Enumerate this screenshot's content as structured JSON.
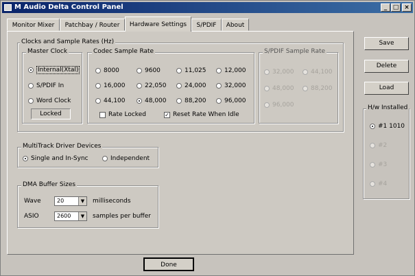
{
  "window": {
    "title": "M Audio Delta Control Panel"
  },
  "tabs": [
    "Monitor Mixer",
    "Patchbay / Router",
    "Hardware Settings",
    "S/PDIF",
    "About"
  ],
  "clocks_group": {
    "title": "Clocks and Sample Rates (Hz)",
    "master_clock": {
      "title": "Master Clock",
      "options": [
        "Internal(Xtal)",
        "S/PDIF In",
        "Word Clock"
      ],
      "selected": "Internal(Xtal)",
      "status": "Locked"
    },
    "codec_rate": {
      "title": "Codec Sample Rate",
      "rates": [
        "8000",
        "9600",
        "11,025",
        "12,000",
        "16,000",
        "22,050",
        "24,000",
        "32,000",
        "44,100",
        "48,000",
        "88,200",
        "96,000"
      ],
      "selected": "48,000",
      "rate_locked": {
        "label": "Rate Locked",
        "checked": false
      },
      "reset_rate": {
        "label": "Reset Rate When Idle",
        "checked": true
      }
    },
    "spdif_rate": {
      "title": "S/PDIF Sample Rate",
      "rates": [
        "32,000",
        "44,100",
        "48,000",
        "88,200",
        "96,000"
      ]
    }
  },
  "multitrack": {
    "title": "MultiTrack Driver Devices",
    "options": [
      "Single and In-Sync",
      "Independent"
    ],
    "selected": "Single and In-Sync"
  },
  "dma": {
    "title": "DMA Buffer Sizes",
    "wave": {
      "label": "Wave",
      "value": "20",
      "unit": "milliseconds"
    },
    "asio": {
      "label": "ASIO",
      "value": "2600",
      "unit": "samples per buffer"
    }
  },
  "side_buttons": {
    "save": "Save",
    "delete": "Delete",
    "load": "Load"
  },
  "hw_installed": {
    "title": "H/w Installed",
    "items": [
      "#1 1010",
      "#2",
      "#3",
      "#4"
    ],
    "selected": "#1 1010"
  },
  "done_label": "Done"
}
